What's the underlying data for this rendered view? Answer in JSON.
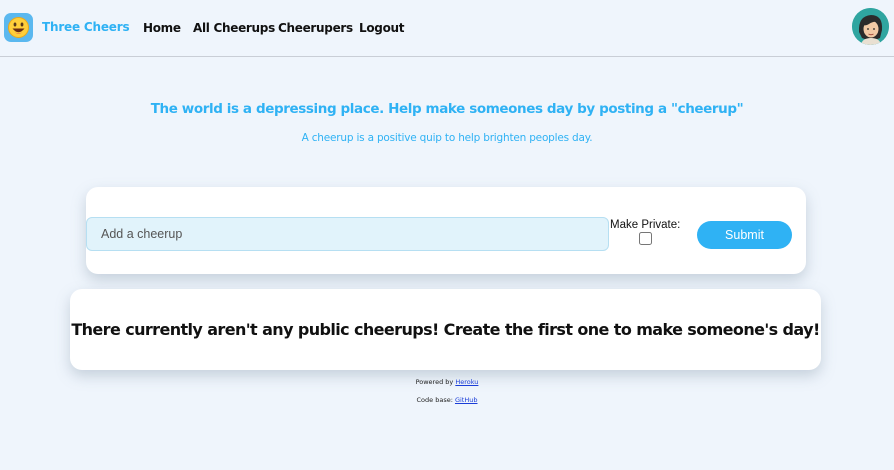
{
  "navbar": {
    "brand_name": "Three Cheers",
    "links": [
      "Home",
      "All Cheerups",
      "Cheerupers",
      "Logout"
    ],
    "logo_icon": "smiley-face-icon",
    "avatar_icon": "user-avatar"
  },
  "hero": {
    "headline": "The world is a depressing place. Help make someones day by posting a \"cheerup\"",
    "subline": "A cheerup is a positive quip to help brighten peoples day."
  },
  "form": {
    "input_placeholder": "Add a cheerup",
    "input_value": "",
    "private_label": "Make Private:",
    "private_checked": false,
    "submit_label": "Submit"
  },
  "feed": {
    "empty_message": "There currently aren't any public cheerups! Create the first one to make someone's day!"
  },
  "footer": {
    "powered_prefix": "Powered by ",
    "powered_link": "Heroku",
    "code_prefix": "Code base: ",
    "code_link": "GitHub"
  },
  "colors": {
    "accent": "#2fb2f4",
    "background": "#eff5fc",
    "input_background": "#e1f3fb"
  }
}
